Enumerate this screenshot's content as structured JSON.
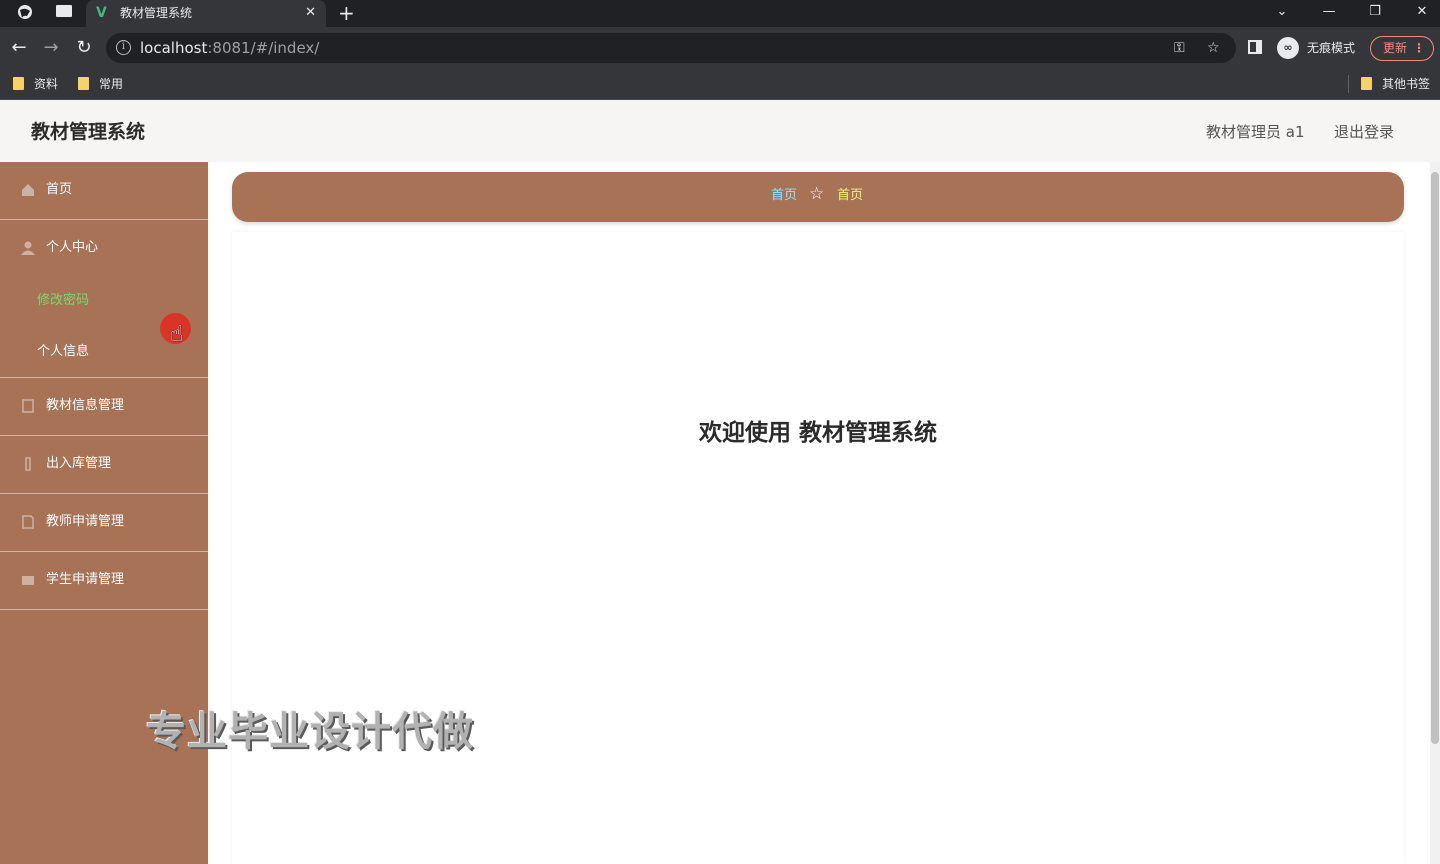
{
  "browser": {
    "tab_title": "教材管理系统",
    "tab_favicon": "V",
    "new_tab_symbol": "+",
    "url_host": "localhost",
    "url_rest": ":8081/#/index/",
    "incognito_label": "无痕模式",
    "update_label": "更新",
    "bookmarks": [
      "资料",
      "常用"
    ],
    "other_bookmarks": "其他书签"
  },
  "header": {
    "title": "教材管理系统",
    "user": "教材管理员 a1",
    "logout": "退出登录"
  },
  "sidebar": {
    "items": [
      {
        "label": "首页",
        "icon": "home-icon"
      },
      {
        "label": "个人中心",
        "icon": "user-icon"
      },
      {
        "label": "教材信息管理",
        "icon": "book-icon"
      },
      {
        "label": "出入库管理",
        "icon": "box-icon"
      },
      {
        "label": "教师申请管理",
        "icon": "doc-icon"
      },
      {
        "label": "学生申请管理",
        "icon": "folder-icon"
      }
    ],
    "submenu": [
      {
        "label": "修改密码",
        "active": true
      },
      {
        "label": "个人信息",
        "active": false
      }
    ]
  },
  "breadcrumb": {
    "home": "首页",
    "current": "首页"
  },
  "main": {
    "welcome": "欢迎使用 教材管理系统"
  },
  "watermark": "专业毕业设计代做",
  "colors": {
    "sidebar": "#a87257",
    "active_submenu": "#7fd86b",
    "breadcrumb_home": "#8fe3ff",
    "breadcrumb_current": "#f3f07a"
  }
}
